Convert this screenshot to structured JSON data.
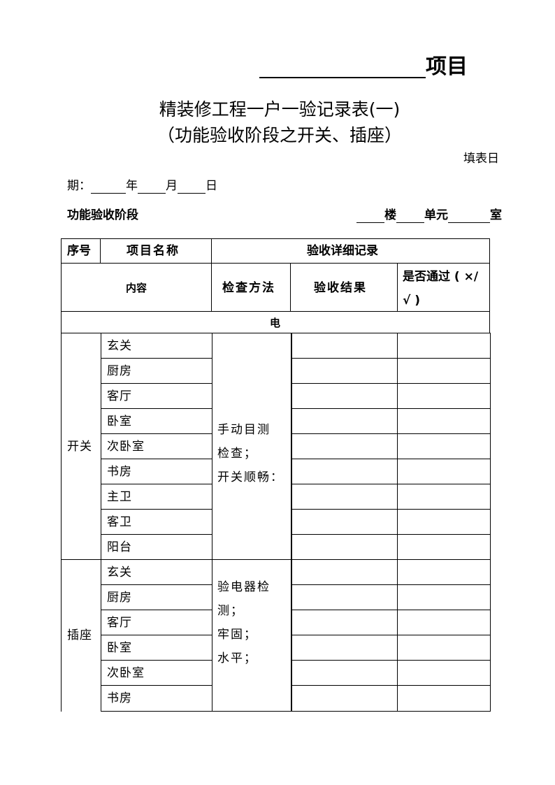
{
  "header": {
    "project_suffix": "项目",
    "title_line1": "精装修工程一户一验记录表(一)",
    "title_line2": "（功能验收阶段之开关、插座）",
    "fill_date_label_part1": "填表日",
    "fill_date_label_part2": "期：",
    "year_label": "年",
    "month_label": "月",
    "day_label": "日",
    "stage_label": "功能验收阶段",
    "building_label": "楼",
    "unit_label": "单元",
    "room_label": "室"
  },
  "table": {
    "headers": {
      "seq": "序号",
      "item_name": "项目名称",
      "detail_record": "验收详细记录",
      "content": "内容",
      "check_method": "检查方法",
      "result": "验收结果",
      "passed_line1": "是否通过 ( ×/",
      "passed_line2": "√ )"
    },
    "section_label": "电",
    "groups": [
      {
        "category": "开关",
        "method_lines": [
          "手动目测",
          "检查；",
          "开关顺畅："
        ],
        "rooms": [
          "玄关",
          "厨房",
          "客厅",
          "卧室",
          "次卧室",
          "书房",
          "主卫",
          "客卫",
          "阳台"
        ]
      },
      {
        "category": "插座",
        "method_lines": [
          "验电器检",
          "测；",
          "牢固；",
          "水平；"
        ],
        "rooms": [
          "玄关",
          "厨房",
          "客厅",
          "卧室",
          "次卧室",
          "书房"
        ]
      }
    ]
  }
}
